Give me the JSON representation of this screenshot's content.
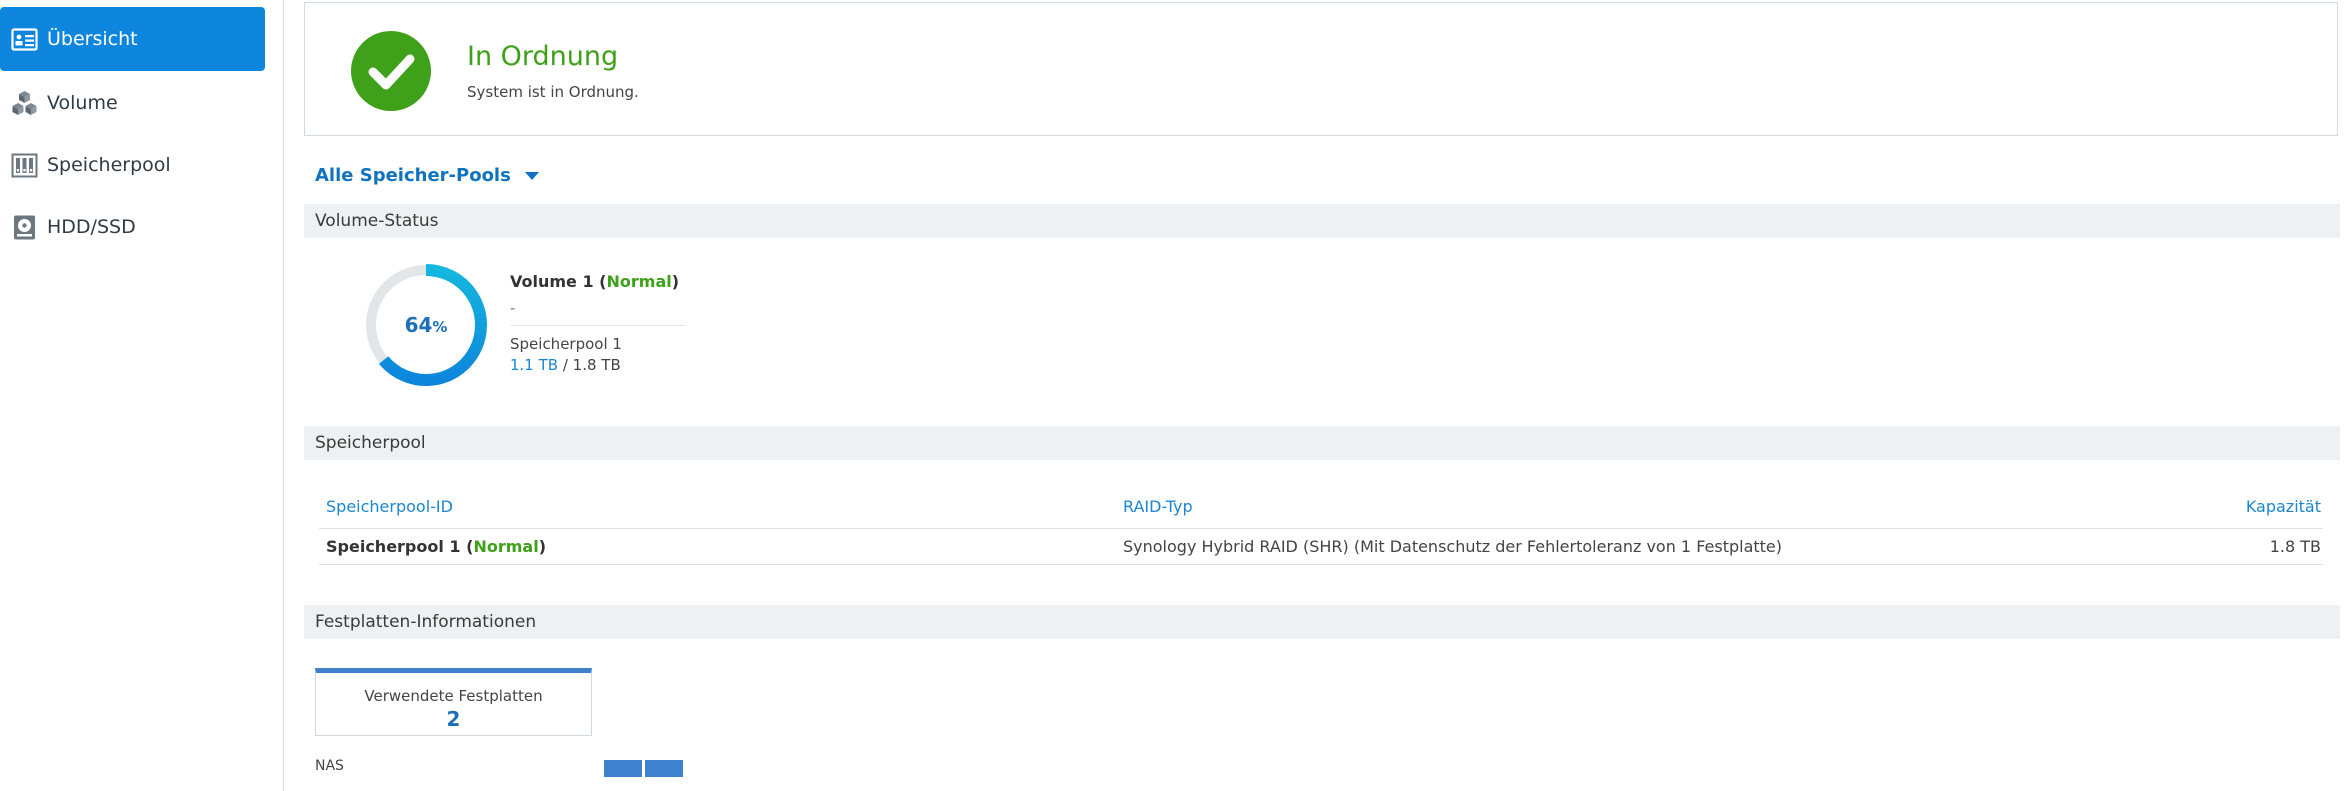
{
  "sidebar": {
    "items": [
      {
        "label": "Übersicht",
        "icon": "overview-icon",
        "active": true
      },
      {
        "label": "Volume",
        "icon": "volume-cubes-icon",
        "active": false
      },
      {
        "label": "Speicherpool",
        "icon": "storage-pool-icon",
        "active": false
      },
      {
        "label": "HDD/SSD",
        "icon": "hdd-icon",
        "active": false
      }
    ]
  },
  "status": {
    "title": "In Ordnung",
    "subtitle": "System ist in Ordnung.",
    "icon": "check-circle-icon",
    "color": "#3fa019"
  },
  "pool_selector": {
    "label": "Alle Speicher-Pools",
    "icon": "caret-down-icon"
  },
  "volume_status": {
    "section_title": "Volume-Status",
    "usage_percent": 64,
    "usage_number": "64",
    "usage_unit": "%",
    "volume_name": "Volume 1",
    "volume_state": "Normal",
    "description": "-",
    "pool_name": "Speicherpool 1",
    "used": "1.1 TB",
    "separator": " / ",
    "total": "1.8 TB"
  },
  "storage_pool": {
    "section_title": "Speicherpool",
    "columns": {
      "id": "Speicherpool-ID",
      "raid": "RAID-Typ",
      "capacity": "Kapazität"
    },
    "rows": [
      {
        "name": "Speicherpool 1",
        "state": "Normal",
        "raid": "Synology Hybrid RAID (SHR) (Mit Datenschutz der Fehlertoleranz von 1 Festplatte)",
        "capacity": "1.8 TB"
      }
    ]
  },
  "disk_info": {
    "section_title": "Festplatten-Informationen",
    "used_disks_label": "Verwendete Festplatten",
    "used_disks_count": "2",
    "nas_label": "NAS"
  },
  "colors": {
    "accent": "#0f86de",
    "ok": "#3fa019",
    "link": "#1c86d0",
    "disk": "#3e82cd"
  }
}
